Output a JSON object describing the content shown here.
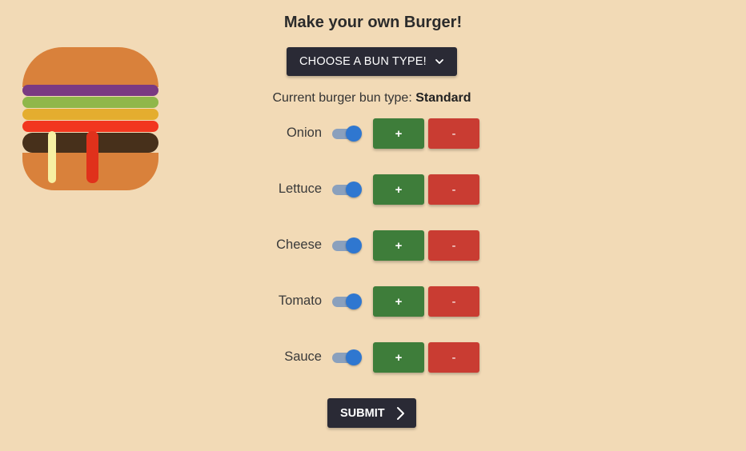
{
  "page": {
    "title": "Make your own Burger!"
  },
  "bun_select": {
    "label": "CHOOSE A BUN TYPE!"
  },
  "current_bun": {
    "prefix": "Current burger bun type: ",
    "value": "Standard"
  },
  "ingredients": [
    {
      "label": "Onion",
      "enabled": true,
      "plus": "+",
      "minus": "-"
    },
    {
      "label": "Lettuce",
      "enabled": true,
      "plus": "+",
      "minus": "-"
    },
    {
      "label": "Cheese",
      "enabled": true,
      "plus": "+",
      "minus": "-"
    },
    {
      "label": "Tomato",
      "enabled": true,
      "plus": "+",
      "minus": "-"
    },
    {
      "label": "Sauce",
      "enabled": true,
      "plus": "+",
      "minus": "-"
    }
  ],
  "submit": {
    "label": "SUBMIT"
  },
  "colors": {
    "background": "#f2dab6",
    "bun": "#d9813b",
    "onion": "#7a3a82",
    "lettuce": "#8fb74a",
    "cheese": "#e4ad2f",
    "tomato": "#f2361f",
    "patty": "#47301b",
    "plus_button": "#3e7d3a",
    "minus_button": "#c93c32",
    "dark_button": "#2a2a35",
    "toggle_thumb": "#2f77d0"
  },
  "icons": {
    "select": "chevron-down-icon",
    "submit": "chevron-right-icon"
  }
}
